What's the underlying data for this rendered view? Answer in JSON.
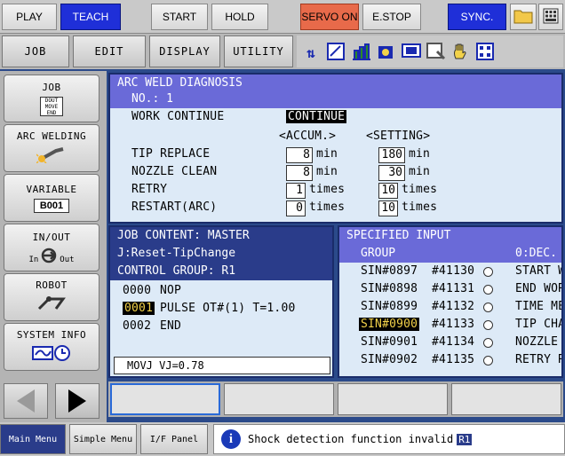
{
  "topbar": {
    "play": "PLAY",
    "teach": "TEACH",
    "start": "START",
    "hold": "HOLD",
    "servo_on": "SERVO ON",
    "estop": "E.STOP",
    "sync": "SYNC.",
    "icons": [
      "folder-icon",
      "keyboard-icon"
    ]
  },
  "menubar": {
    "job": "JOB",
    "edit": "EDIT",
    "display": "DISPLAY",
    "utility": "UTILITY",
    "toolbar_icons": [
      "sort-icon",
      "edit-icon",
      "graph-icon",
      "weld-icon",
      "monitor-icon",
      "cursor-icon",
      "hand-icon",
      "grid-icon"
    ]
  },
  "sidemenu": {
    "job": "JOB",
    "job_icon_text": "DOUT MOVE END",
    "arc_welding": "ARC WELDING",
    "variable": "VARIABLE",
    "variable_tag": "B001",
    "in_out": "IN/OUT",
    "in_label": "In",
    "out_label": "Out",
    "robot": "ROBOT",
    "system_info": "SYSTEM INFO"
  },
  "diag": {
    "title": "ARC WELD DIAGNOSIS",
    "no": "NO.: 1",
    "work_continue": "WORK CONTINUE",
    "continue_value": "CONTINUE",
    "accum_header": "<ACCUM.>",
    "setting_header": "<SETTING>",
    "rows": [
      {
        "label": "TIP REPLACE",
        "accum": "8",
        "accum_unit": "min",
        "setting": "180",
        "setting_unit": "min"
      },
      {
        "label": "NOZZLE CLEAN",
        "accum": "8",
        "accum_unit": "min",
        "setting": "30",
        "setting_unit": "min"
      },
      {
        "label": "RETRY",
        "accum": "1",
        "accum_unit": "times",
        "setting": "10",
        "setting_unit": "times"
      },
      {
        "label": "RESTART(ARC)",
        "accum": "0",
        "accum_unit": "times",
        "setting": "10",
        "setting_unit": "times"
      }
    ]
  },
  "job": {
    "content": "JOB CONTENT: MASTER",
    "name": "J:Reset-TipChange",
    "group": "CONTROL GROUP: R1",
    "lines": [
      {
        "no": "0000",
        "text": "NOP"
      },
      {
        "no": "0001",
        "text": "PULSE OT#(1) T=1.00"
      },
      {
        "no": "0002",
        "text": "END"
      }
    ],
    "command": "MOVJ VJ=0.78"
  },
  "spec": {
    "title": "SPECIFIED INPUT",
    "group": "GROUP",
    "dec": "0:DEC.",
    "rows": [
      {
        "sin": "SIN#0897",
        "addr": "#41130",
        "desc": "START WO"
      },
      {
        "sin": "SIN#0898",
        "addr": "#41131",
        "desc": "END WOR"
      },
      {
        "sin": "SIN#0899",
        "addr": "#41132",
        "desc": "TIME ME"
      },
      {
        "sin": "SIN#0900",
        "addr": "#41133",
        "desc": "TIP CHA"
      },
      {
        "sin": "SIN#0901",
        "addr": "#41134",
        "desc": "NOZZLE"
      },
      {
        "sin": "SIN#0902",
        "addr": "#41135",
        "desc": "RETRY R"
      }
    ]
  },
  "statusbar": {
    "main_menu": "Main Menu",
    "simple_menu": "Simple Menu",
    "if_panel": "I/F Panel",
    "message": "Shock detection function invalid",
    "tag": "R1",
    "info_glyph": "i"
  },
  "colors": {
    "teach_blue": "#1f2fd8",
    "servo_red": "#e86a4a",
    "panel_bg": "#ddeaf7",
    "header_purple": "#6a6ad8",
    "dark_navy": "#2a3c8a"
  }
}
